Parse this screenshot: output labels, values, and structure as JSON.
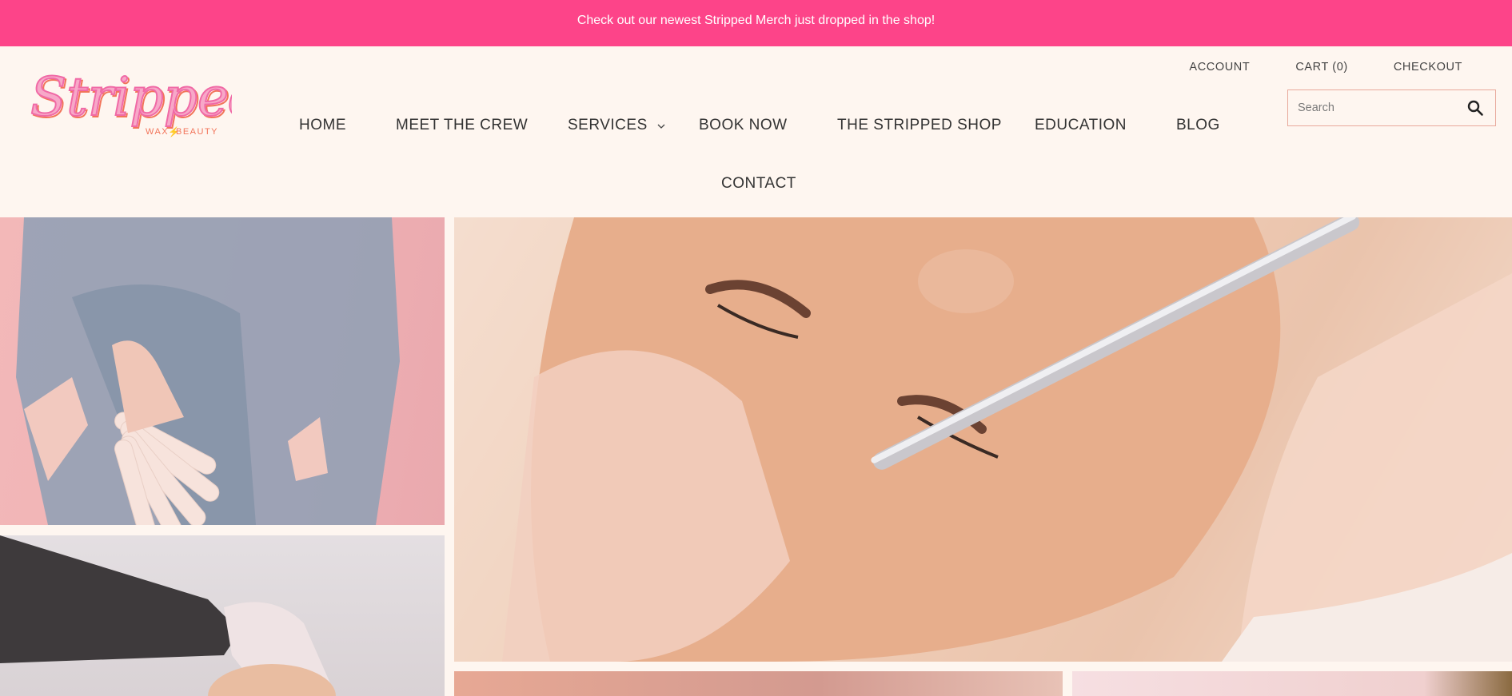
{
  "announcement": {
    "text": "Check out our newest Stripped Merch just dropped in the shop!"
  },
  "utility_nav": {
    "account": "ACCOUNT",
    "cart": "CART (0)",
    "checkout": "CHECKOUT"
  },
  "logo": {
    "script": "Stripped",
    "tagline_left": "WAX",
    "tagline_right": "BEAUTY"
  },
  "main_nav": {
    "home": "HOME",
    "crew": "MEET THE CREW",
    "services": "SERVICES",
    "book": "BOOK NOW",
    "shop": "THE STRIPPED SHOP",
    "education": "EDUCATION",
    "blog": "BLOG",
    "contact": "CONTACT"
  },
  "search": {
    "placeholder": "Search",
    "icon": "search-icon"
  },
  "colors": {
    "banner": "#fd4489",
    "background": "#fef6f0",
    "logo_pink": "#f06aa6",
    "logo_orange": "#f2745a"
  }
}
